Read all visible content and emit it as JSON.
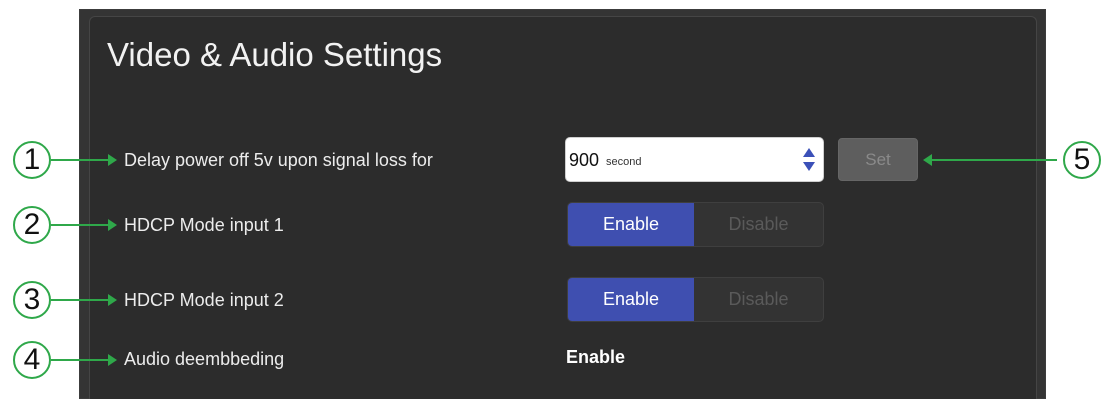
{
  "title": "Video & Audio Settings",
  "rows": [
    {
      "callout": "1",
      "label": "Delay power off 5v upon signal loss for"
    },
    {
      "callout": "2",
      "label": "HDCP Mode input 1"
    },
    {
      "callout": "3",
      "label": "HDCP Mode input 2"
    },
    {
      "callout": "4",
      "label": "Audio deembbeding"
    }
  ],
  "delay": {
    "value": "900",
    "unit": "second",
    "set_label": "Set",
    "callout": "5"
  },
  "hdcp1": {
    "enable_label": "Enable",
    "disable_label": "Disable",
    "selected": "Enable"
  },
  "hdcp2": {
    "enable_label": "Enable",
    "disable_label": "Disable",
    "selected": "Enable"
  },
  "audio": {
    "value": "Enable"
  },
  "colors": {
    "accent": "#3f4fb0",
    "callout_green": "#2fa84a",
    "panel": "#2c2c2c"
  }
}
